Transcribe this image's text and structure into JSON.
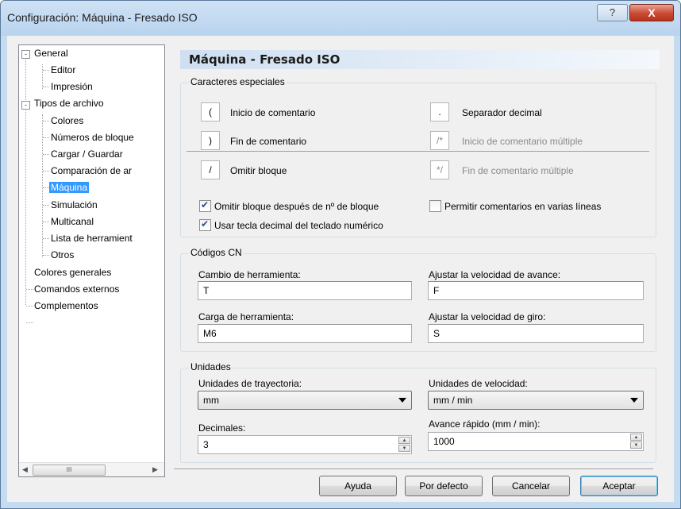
{
  "window": {
    "title": "Configuración: Máquina - Fresado ISO",
    "help_symbol": "?",
    "close_symbol": "X"
  },
  "tree": {
    "items": [
      {
        "label": "General",
        "expander": "-"
      },
      {
        "label": "Editor"
      },
      {
        "label": "Impresión"
      },
      {
        "label": "Tipos de archivo",
        "expander": "-"
      },
      {
        "label": "Colores"
      },
      {
        "label": "Números de bloque"
      },
      {
        "label": "Cargar / Guardar"
      },
      {
        "label": "Comparación de ar"
      },
      {
        "label": "Máquina",
        "selected": true
      },
      {
        "label": "Simulación"
      },
      {
        "label": "Multicanal"
      },
      {
        "label": "Lista de herramient"
      },
      {
        "label": "Otros"
      },
      {
        "label": "Colores generales"
      },
      {
        "label": "Comandos externos"
      },
      {
        "label": "Complementos"
      }
    ],
    "scroll_left": "◀",
    "scroll_right": "▶",
    "scroll_grip": "III"
  },
  "header": {
    "title": "Máquina - Fresado ISO"
  },
  "special_chars": {
    "group_title": "Caracteres especiales",
    "items": [
      {
        "char": "(",
        "label": "Inicio de comentario"
      },
      {
        "char": ")",
        "label": "Fin de comentario"
      },
      {
        "char": "/",
        "label": "Omitir bloque"
      },
      {
        "char": ".",
        "label": "Separador decimal"
      },
      {
        "char": "/*",
        "label": "Inicio de comentario múltiple",
        "disabled": true
      },
      {
        "char": "*/",
        "label": "Fin de comentario múltiple",
        "disabled": true
      }
    ],
    "checkboxes": [
      {
        "label": "Omitir bloque después de nº de bloque",
        "checked": true
      },
      {
        "label": "Usar tecla decimal del teclado numérico",
        "checked": true
      },
      {
        "label": "Permitir comentarios en varias líneas",
        "checked": false
      }
    ]
  },
  "nc_codes": {
    "group_title": "Códigos CN",
    "tool_change": {
      "label": "Cambio de herramienta:",
      "value": "T"
    },
    "tool_load": {
      "label": "Carga de herramienta:",
      "value": "M6"
    },
    "feed_rate": {
      "label": "Ajustar la velocidad de avance:",
      "value": "F"
    },
    "spindle_speed": {
      "label": "Ajustar la velocidad de giro:",
      "value": "S"
    }
  },
  "units": {
    "group_title": "Unidades",
    "path_units": {
      "label": "Unidades de trayectoria:",
      "value": "mm"
    },
    "speed_units": {
      "label": "Unidades de velocidad:",
      "value": "mm / min"
    },
    "decimals": {
      "label": "Decimales:",
      "value": "3"
    },
    "rapid_feed": {
      "label": "Avance rápido (mm / min):",
      "value": "1000"
    }
  },
  "buttons": {
    "help": "Ayuda",
    "defaults": "Por defecto",
    "cancel": "Cancelar",
    "accept": "Aceptar"
  }
}
